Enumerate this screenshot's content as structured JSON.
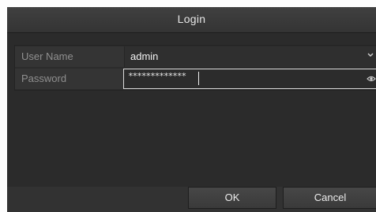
{
  "dialog": {
    "title": "Login"
  },
  "form": {
    "username_label": "User Name",
    "username_value": "admin",
    "password_label": "Password",
    "password_value": "*************"
  },
  "buttons": {
    "ok_label": "OK",
    "cancel_label": "Cancel"
  },
  "icons": {
    "dropdown": "chevron-down-icon",
    "show_password": "eye-icon"
  }
}
